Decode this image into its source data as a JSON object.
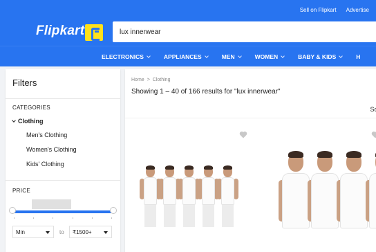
{
  "header": {
    "top_links": [
      "Sell on Flipkart",
      "Advertise"
    ],
    "logo_text": "Flipkart",
    "search_value": "lux innerwear",
    "nav_items": [
      "ELECTRONICS",
      "APPLIANCES",
      "MEN",
      "WOMEN",
      "BABY & KIDS",
      "H"
    ]
  },
  "sidebar": {
    "title": "Filters",
    "categories_label": "CATEGORIES",
    "category": "Clothing",
    "subcategories": [
      "Men's Clothing",
      "Women's Clothing",
      "Kids' Clothing"
    ],
    "price_label": "PRICE",
    "min_value": "Min",
    "to_label": "to",
    "max_value": "₹1500+"
  },
  "main": {
    "breadcrumb": [
      "Home",
      "Clothing"
    ],
    "results_text": "Showing 1 – 40 of 166 results for \"lux innerwear\"",
    "sort_label": "Sort"
  },
  "colors": {
    "brand_blue": "#2874f0",
    "logo_yellow": "#ffe11b",
    "page_bg": "#f1f3f6"
  }
}
